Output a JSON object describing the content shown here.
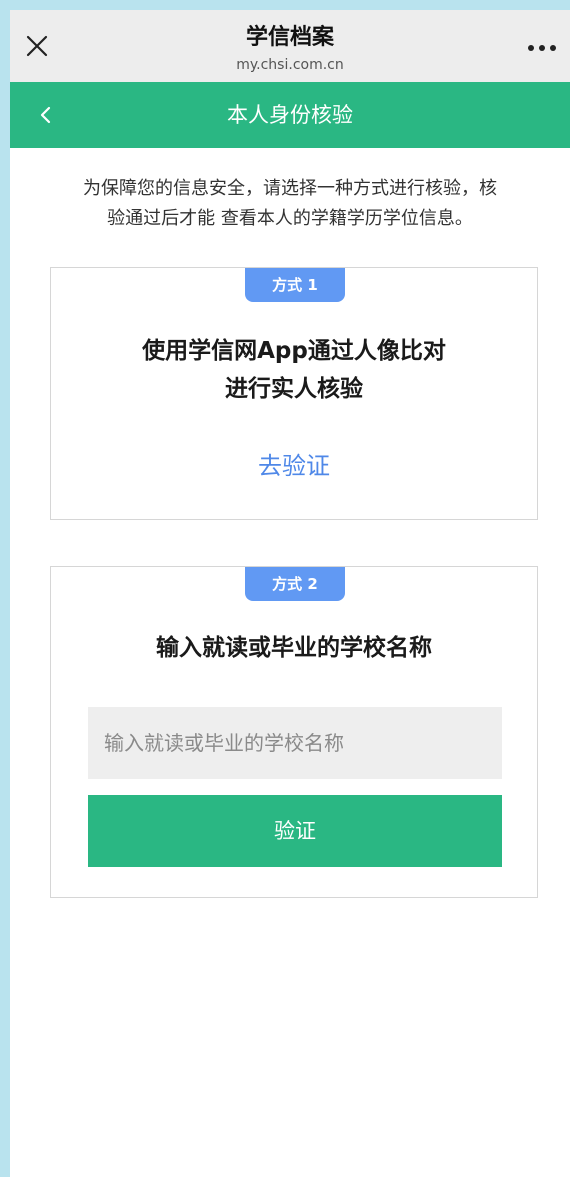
{
  "browser": {
    "title": "学信档案",
    "url": "my.chsi.com.cn"
  },
  "nav": {
    "title": "本人身份核验"
  },
  "intro": {
    "line1": "为保障您的信息安全，请选择一种方式进行核验，核",
    "line2": "验通过后才能 查看本人的学籍学历学位信息。"
  },
  "method1": {
    "badge": "方式 1",
    "title_line1": "使用学信网App通过人像比对",
    "title_line2": "进行实人核验",
    "link": "去验证"
  },
  "method2": {
    "badge": "方式 2",
    "title": "输入就读或毕业的学校名称",
    "input_value": "",
    "input_placeholder": "输入就读或毕业的学校名称",
    "button": "验证"
  },
  "colors": {
    "outer_bg": "#b9e3ee",
    "brand_green": "#2ab783",
    "badge_blue": "#6199f3",
    "link_blue": "#4f88e8"
  },
  "icons": {
    "close": "close-icon",
    "more": "more-icon",
    "back": "chevron-left-icon"
  }
}
